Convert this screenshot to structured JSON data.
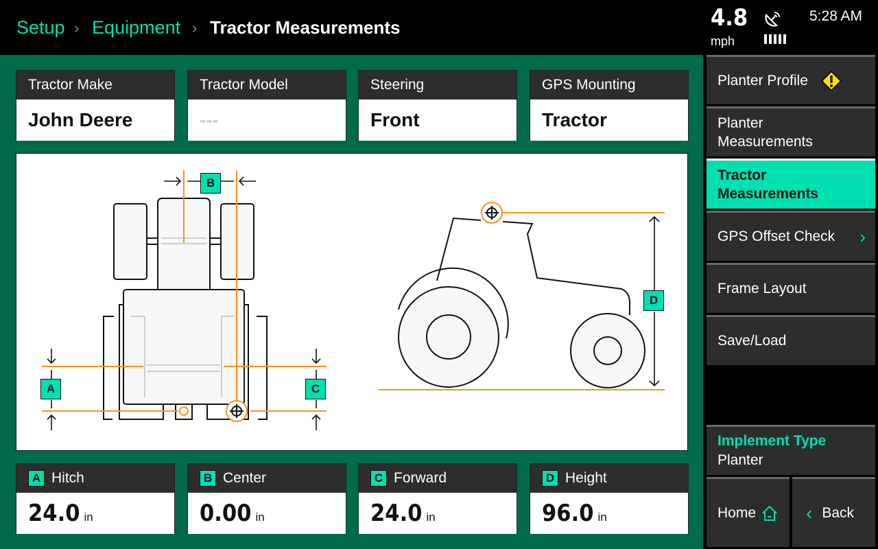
{
  "breadcrumb": [
    "Setup",
    "Equipment",
    "Tractor Measurements"
  ],
  "status": {
    "speed": "4.8",
    "speed_unit": "mph",
    "time": "5:28 AM",
    "gps_icon": "satellite-dish-icon",
    "signal_bars": 5
  },
  "info_cards": [
    {
      "label": "Tractor Make",
      "value": "John Deere"
    },
    {
      "label": "Tractor Model",
      "value": "---"
    },
    {
      "label": "Steering",
      "value": "Front"
    },
    {
      "label": "GPS Mounting",
      "value": "Tractor"
    }
  ],
  "diagram_labels": [
    "A",
    "B",
    "C",
    "D"
  ],
  "measurements": [
    {
      "badge": "A",
      "label": "Hitch",
      "value": "24.0",
      "unit": "in"
    },
    {
      "badge": "B",
      "label": "Center",
      "value": "0.00",
      "unit": "in"
    },
    {
      "badge": "C",
      "label": "Forward",
      "value": "24.0",
      "unit": "in"
    },
    {
      "badge": "D",
      "label": "Height",
      "value": "96.0",
      "unit": "in"
    }
  ],
  "sidebar": {
    "items": [
      {
        "label": "Planter Profile",
        "warning": true
      },
      {
        "label": "Planter Measurements"
      },
      {
        "label": "Tractor Measurements",
        "active": true
      },
      {
        "label": "GPS Offset Check"
      },
      {
        "label": "Frame Layout"
      },
      {
        "label": "Save/Load"
      }
    ],
    "implement_type_label": "Implement Type",
    "implement_type_value": "Planter",
    "home": "Home",
    "back": "Back"
  },
  "colors": {
    "accent": "#00e0b0",
    "background": "#006b4b",
    "line": "#f7931e",
    "warning": "#ffe000"
  }
}
